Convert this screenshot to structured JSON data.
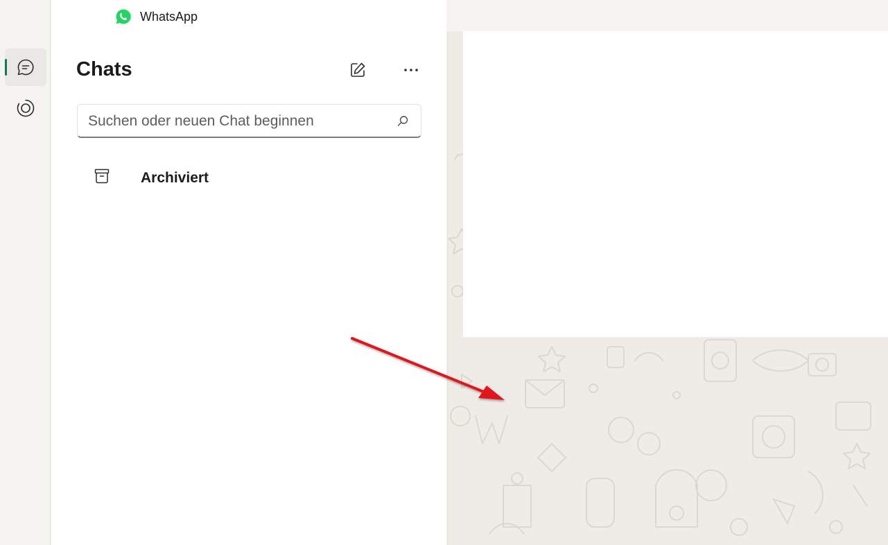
{
  "window": {
    "title": "WhatsApp"
  },
  "rail": {
    "items": [
      {
        "icon": "chat-bubble-icon",
        "active": true
      },
      {
        "icon": "status-icon",
        "active": false
      }
    ],
    "accent_color": "#0f7a55"
  },
  "chats_panel": {
    "title": "Chats",
    "new_chat_icon": "compose-icon",
    "menu_icon": "more-options-icon",
    "search": {
      "placeholder": "Suchen oder neuen Chat beginnen",
      "value": ""
    },
    "archived": {
      "label": "Archiviert",
      "icon": "archive-icon"
    }
  },
  "colors": {
    "brand": "#25d366",
    "accent": "#0f7a55",
    "annotation_arrow": "#e0141b"
  }
}
